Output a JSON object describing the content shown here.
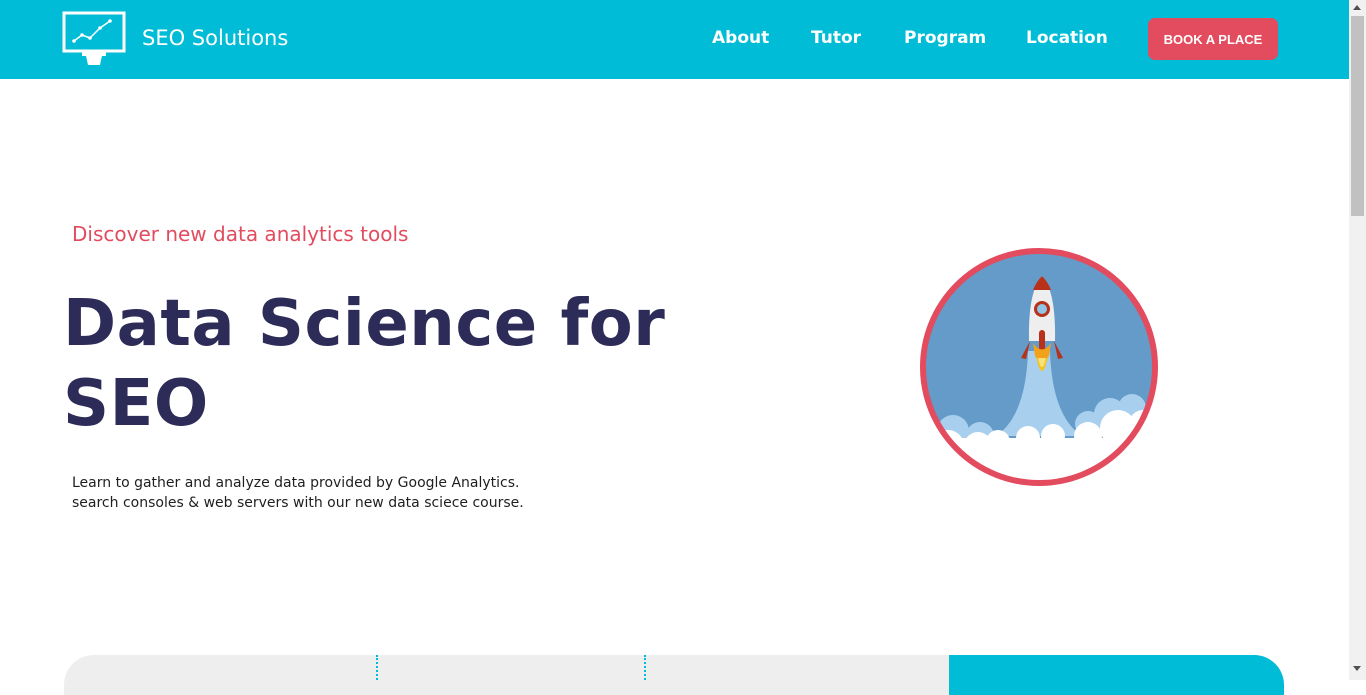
{
  "header": {
    "brand": "SEO Solutions",
    "nav": [
      "About",
      "Tutor",
      "Program",
      "Location"
    ],
    "cta_label": "BOOK A PLACE"
  },
  "hero": {
    "subtitle": "Discover new data analytics tools",
    "title_line1": "Data Science for",
    "title_line2": "SEO",
    "description_line1": "Learn to gather and analyze data provided by Google Analytics.",
    "description_line2": "search consoles & web servers with our new data sciece course."
  },
  "colors": {
    "primary": "#00bcd6",
    "accent": "#e24c5e",
    "heading": "#2d2b57",
    "illustration_bg": "#659bc8"
  },
  "icons": {
    "logo": "monitor-chart-icon",
    "illustration": "rocket-launch-icon"
  }
}
